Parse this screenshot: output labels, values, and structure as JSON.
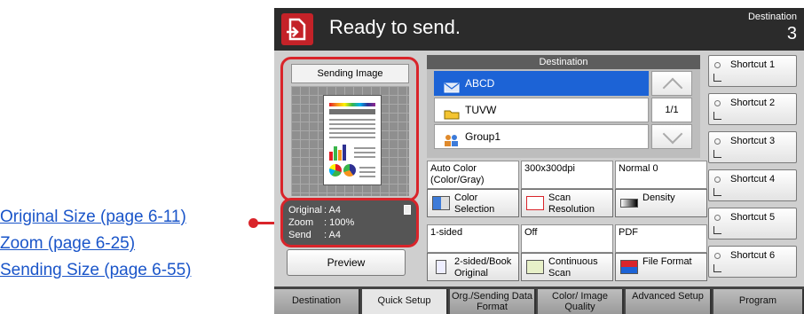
{
  "callouts": [
    "Original Size (page 6-11)",
    "Zoom (page 6-25)",
    "Sending Size (page 6-55)"
  ],
  "header": {
    "title": "Ready to send.",
    "destination_label": "Destination",
    "destination_count": "3"
  },
  "sending_image": {
    "title": "Sending Image"
  },
  "info": {
    "original_key": "Original",
    "original_val": ": A4",
    "zoom_key": "Zoom",
    "zoom_val": ": 100%",
    "send_key": "Send",
    "send_val": ": A4"
  },
  "preview_label": "Preview",
  "destination": {
    "header": "Destination",
    "items": [
      {
        "label": "ABCD",
        "icon": "envelope-icon"
      },
      {
        "label": "TUVW",
        "icon": "folder-icon"
      },
      {
        "label": "Group1",
        "icon": "group-icon"
      }
    ],
    "page": "1/1"
  },
  "functions": {
    "color_val": "Auto Color (Color/Gray)",
    "color_btn": "Color Selection",
    "res_val": "300x300dpi",
    "res_btn": "Scan Resolution",
    "density_val": "Normal 0",
    "density_btn": "Density",
    "duplex_val": "1-sided",
    "duplex_btn": "2-sided/Book Original",
    "cont_val": "Off",
    "cont_btn": "Continuous Scan",
    "format_val": "PDF",
    "format_btn": "File Format"
  },
  "shortcuts": [
    "Shortcut 1",
    "Shortcut 2",
    "Shortcut 3",
    "Shortcut 4",
    "Shortcut 5",
    "Shortcut 6"
  ],
  "tabs": [
    "Destination",
    "Quick Setup",
    "Org./Sending Data Format",
    "Color/ Image Quality",
    "Advanced Setup",
    "Program"
  ],
  "colors": {
    "highlight": "#d9242a",
    "selected": "#1c63d6",
    "link": "#1a55c9"
  }
}
